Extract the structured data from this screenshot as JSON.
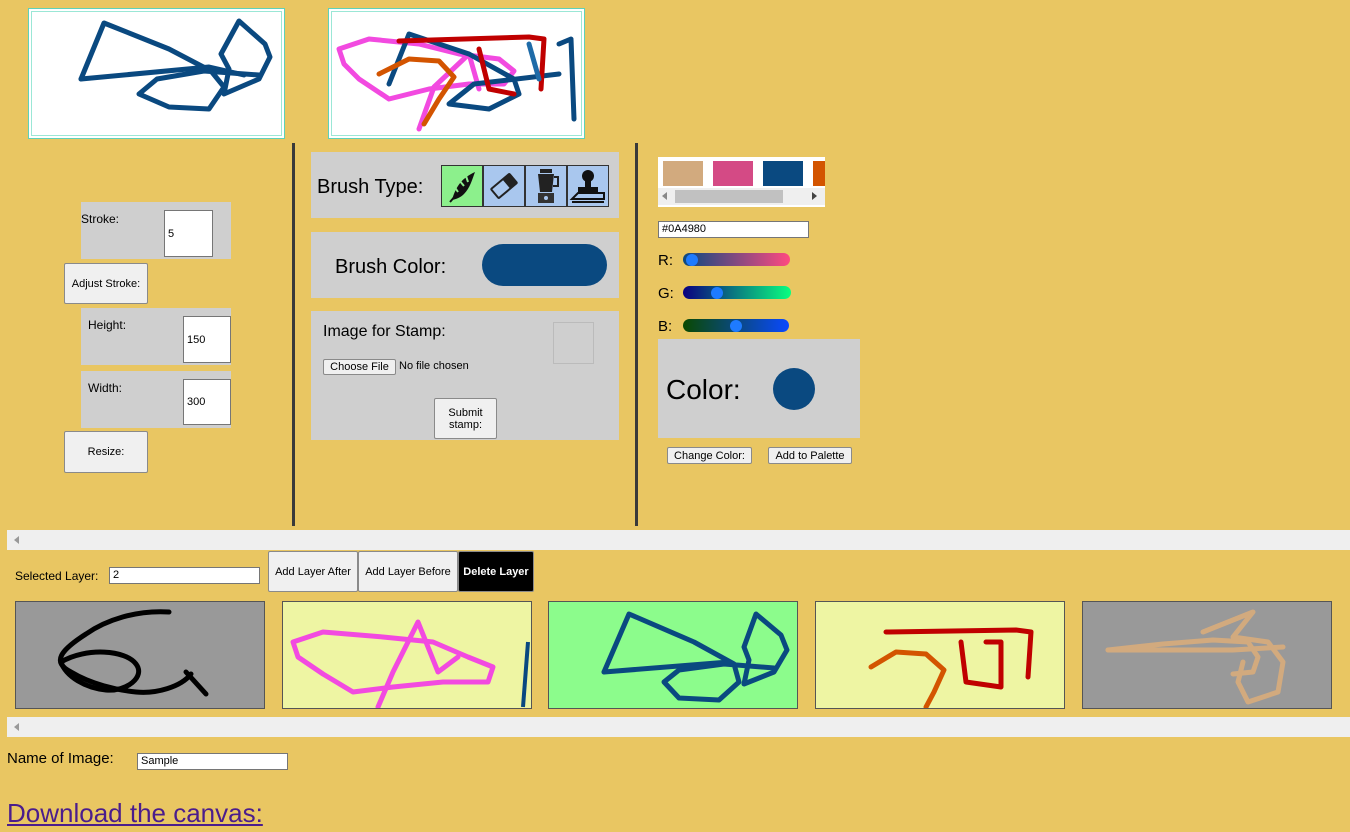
{
  "controls": {
    "stroke_label": "Stroke:",
    "stroke_value": "5",
    "adjust_stroke": "Adjust Stroke:",
    "height_label": "Height:",
    "height_value": "150",
    "width_label": "Width:",
    "width_value": "300",
    "resize": "Resize:"
  },
  "brush": {
    "type_label": "Brush Type:",
    "tools": [
      "leaf-brush-icon",
      "eraser-icon",
      "blender-icon",
      "stamp-icon"
    ],
    "color_label": "Brush Color:",
    "color": "#0A4980",
    "stamp_label": "Image for Stamp:",
    "choose_file": "Choose File",
    "no_file": "No file chosen",
    "submit_stamp": "Submit stamp:"
  },
  "palette": {
    "swatches": [
      "#D2AA7E",
      "#D44A85",
      "#0A4980",
      "#D35400"
    ],
    "hex_value": "#0A4980",
    "r_label": "R:",
    "g_label": "G:",
    "b_label": "B:",
    "r_value": 10,
    "g_value": 73,
    "b_value": 128,
    "color_label": "Color:",
    "change_color": "Change Color:",
    "add_to_palette": "Add to Palette"
  },
  "layers": {
    "selected_label": "Selected Layer:",
    "selected_value": "2",
    "add_after": "Add Layer After",
    "add_before": "Add Layer Before",
    "delete": "Delete Layer"
  },
  "footer": {
    "name_label": "Name of Image:",
    "name_value": "Sample",
    "download": "Download the canvas:"
  }
}
